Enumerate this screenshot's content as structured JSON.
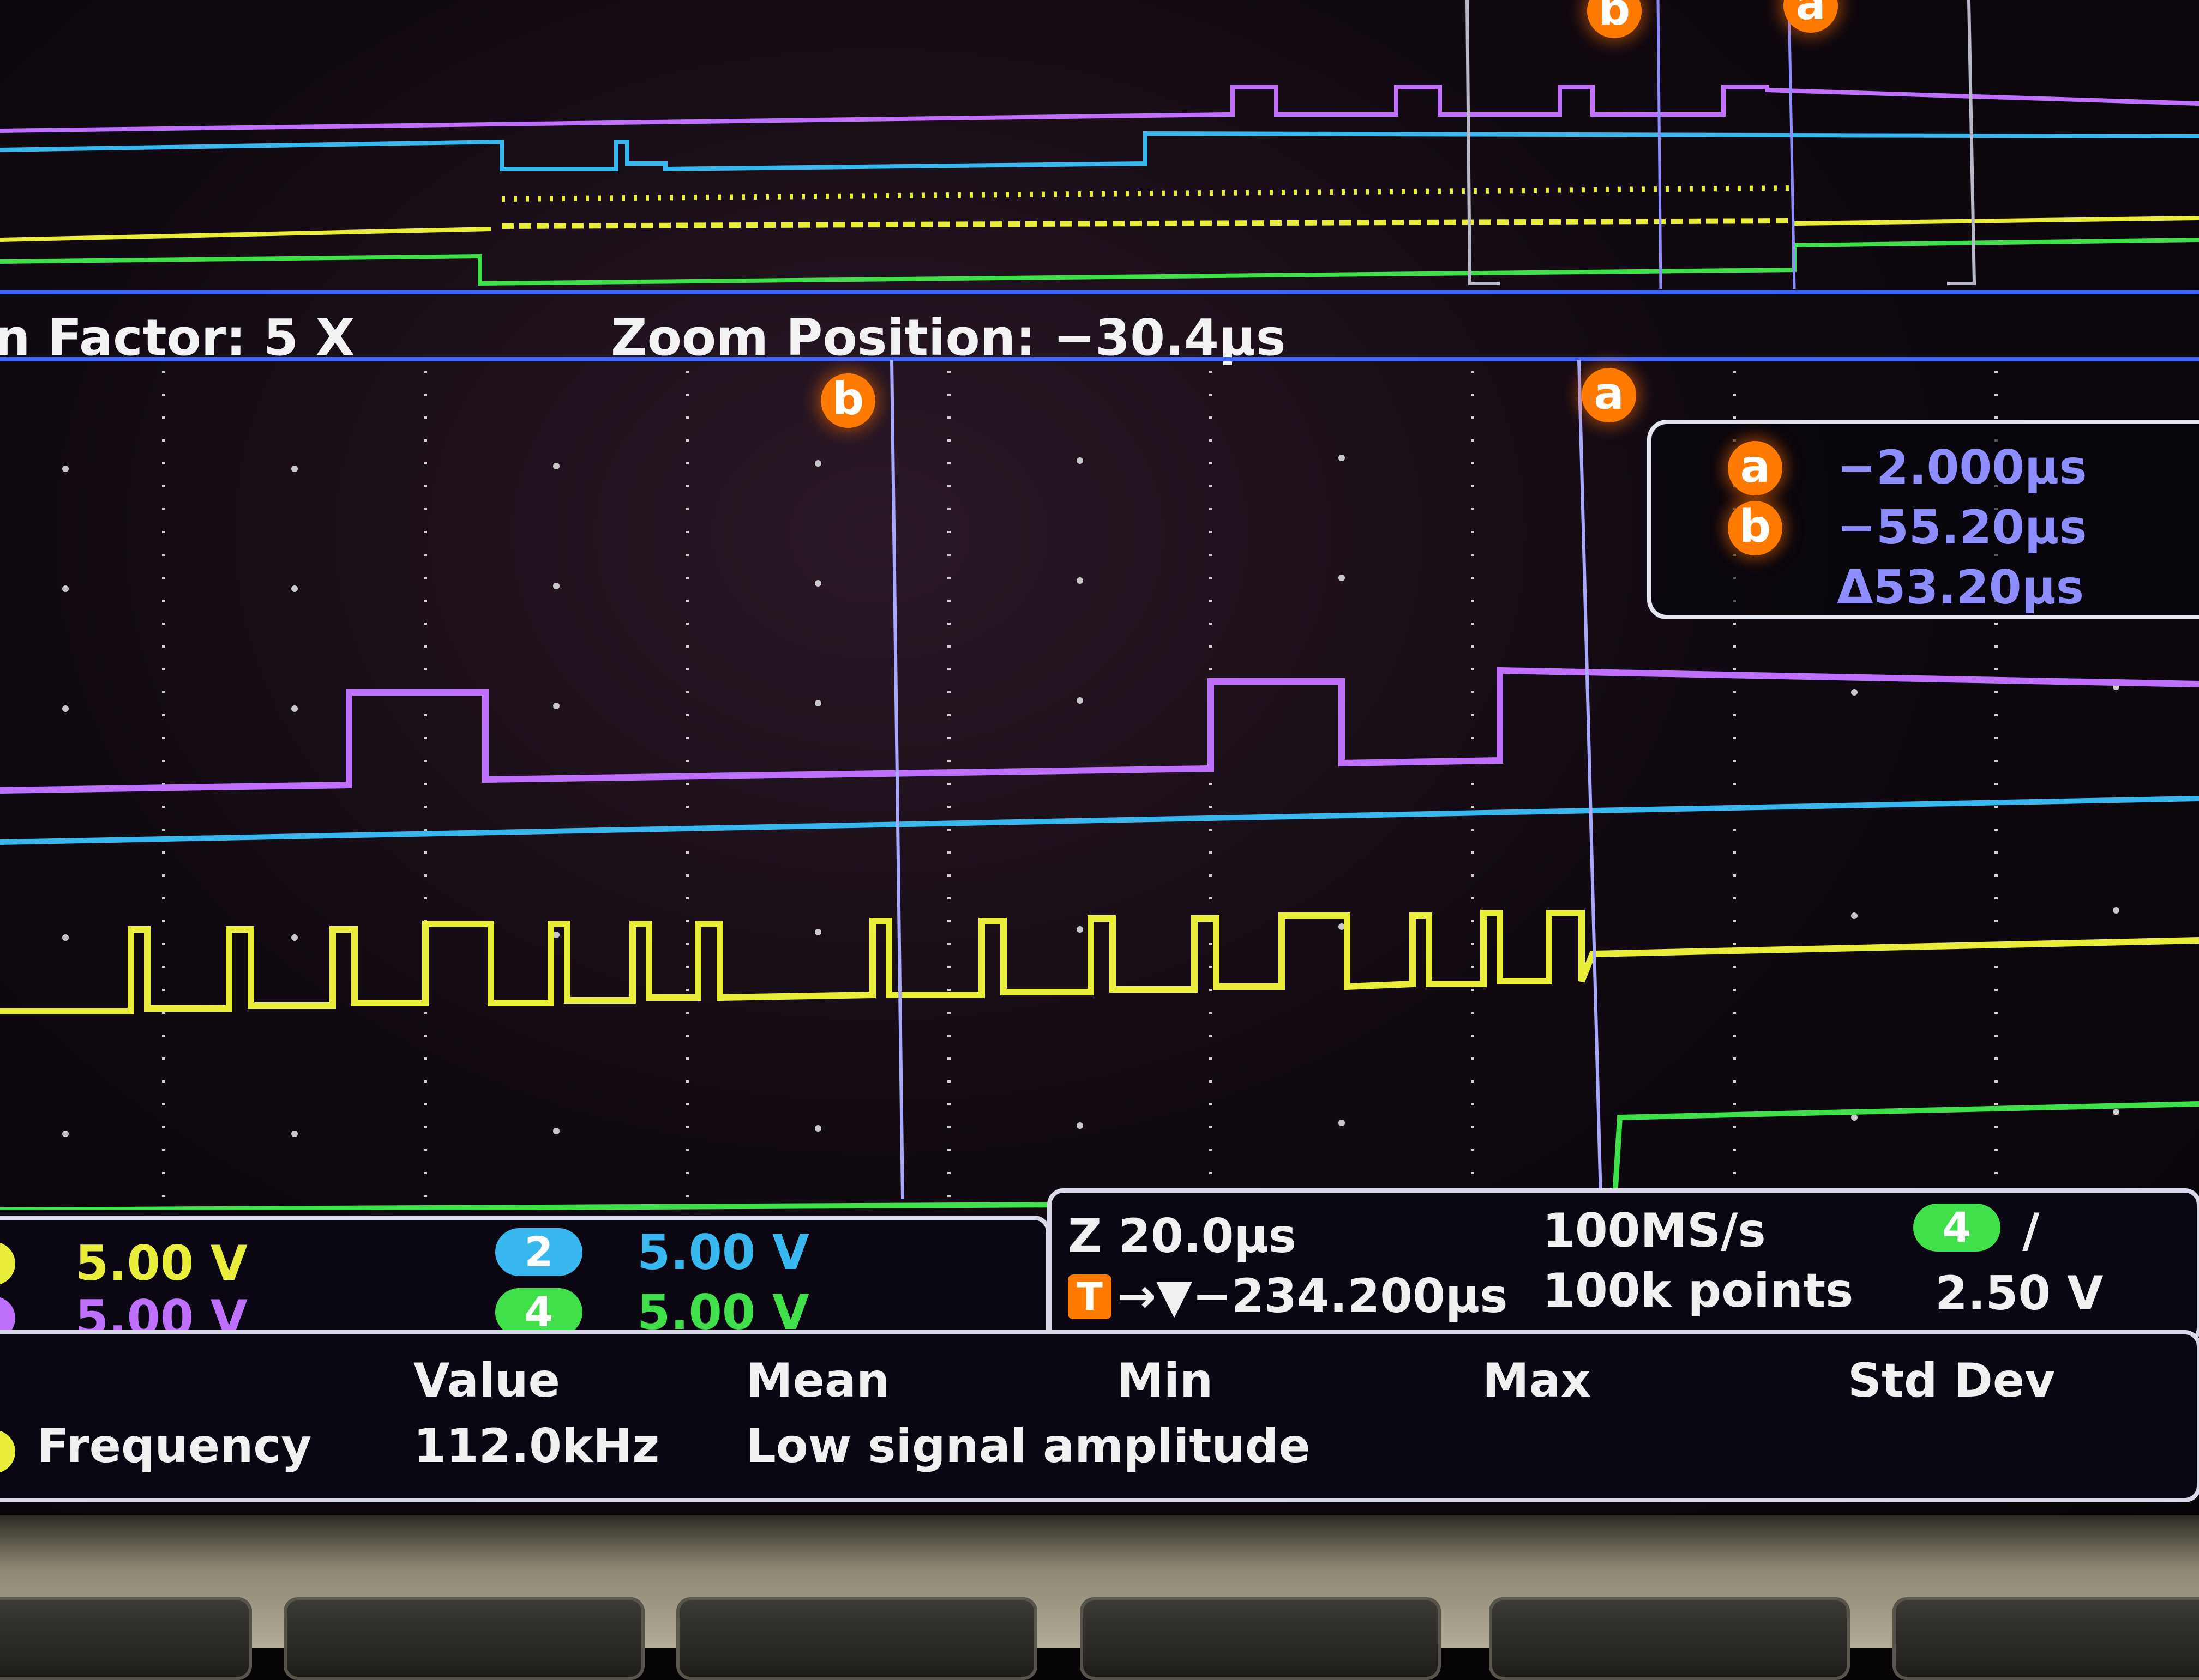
{
  "overview": {
    "cursor_a_label": "a",
    "cursor_b_label": "b"
  },
  "zoom": {
    "factor": "n Factor: 5 X",
    "position": "Zoom Position: −30.4μs"
  },
  "cursors": {
    "a_label": "a",
    "b_label": "b",
    "a_value": "−2.000μs",
    "b_value": "−55.20μs",
    "delta_value": "Δ53.20μs"
  },
  "channels": {
    "ch1_scale": "5.00 V",
    "ch3_scale": "5.00 V",
    "ch2_label": "2",
    "ch2_scale": "5.00 V",
    "ch4_label": "4",
    "ch4_scale": "5.00 V"
  },
  "timebase": {
    "zoom_scale": "Z 20.0μs",
    "trigger_position": "→▼−234.200μs",
    "trigger_icon_label": "T",
    "sample_rate": "100MS/s",
    "record_length": "100k points",
    "trigger_source": "4",
    "trigger_slope": "/",
    "trigger_level": "2.50 V"
  },
  "measurements": {
    "headers": [
      "Value",
      "Mean",
      "Min",
      "Max",
      "Std Dev"
    ],
    "row_name": "Frequency",
    "row_value": "112.0kHz",
    "row_note": "Low signal amplitude"
  },
  "colors": {
    "ch1": "#e8ee3a",
    "ch2": "#39b8f0",
    "ch3": "#c070ff",
    "ch4": "#3fe04a",
    "cursor": "#ff7a00",
    "frame": "#3f63ff"
  }
}
